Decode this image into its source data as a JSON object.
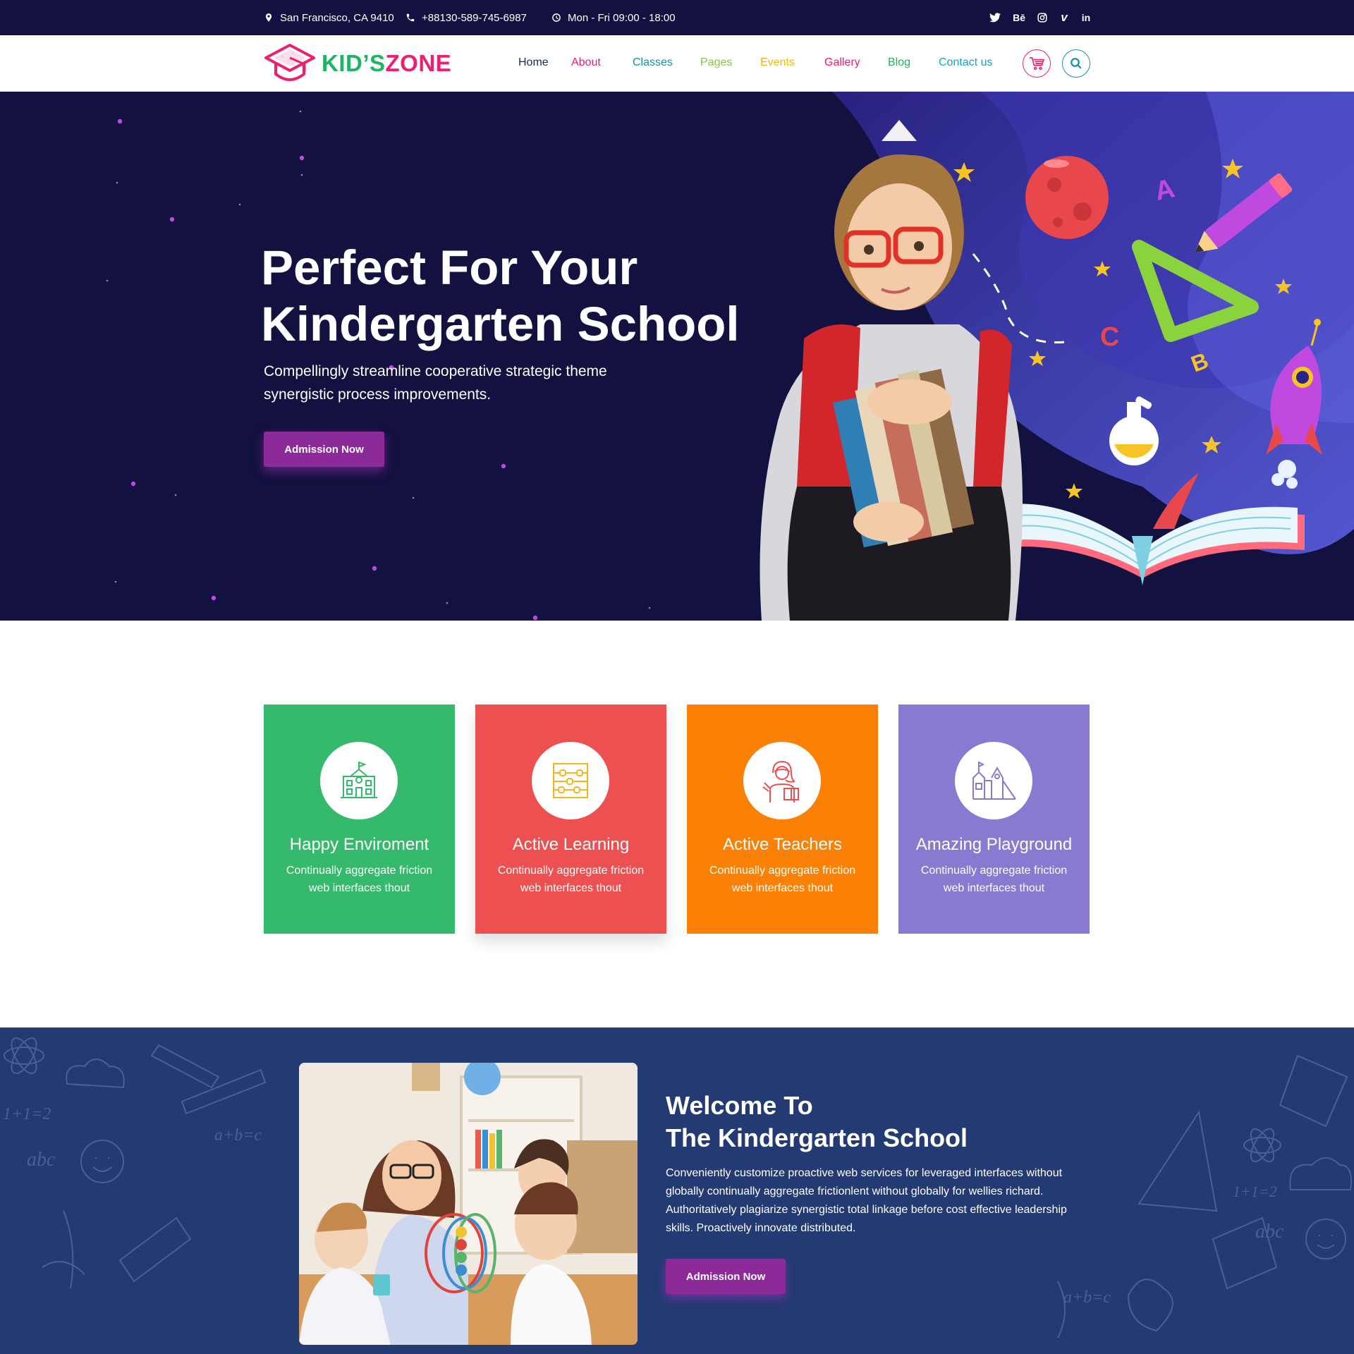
{
  "topbar": {
    "location": "San Francisco, CA 9410",
    "phone": "+88130-589-745-6987",
    "hours": "Mon - Fri 09:00 - 18:00",
    "social": [
      "twitter-icon",
      "behance-icon",
      "instagram-icon",
      "vimeo-icon",
      "linkedin-icon"
    ],
    "social_glyphs": {
      "behance": "Bē",
      "vimeo": "v",
      "linkedin": "in"
    }
  },
  "header": {
    "logo_part1": "KID’S",
    "logo_part2": "ZONE",
    "nav": [
      {
        "label": "Home",
        "color": "#1d2a4d"
      },
      {
        "label": "About",
        "color": "#ec1f70"
      },
      {
        "label": "Classes",
        "color": "#1a8fa6"
      },
      {
        "label": "Pages",
        "color": "#8bc34a"
      },
      {
        "label": "Events",
        "color": "#f5b800"
      },
      {
        "label": "Gallery",
        "color": "#ec1f70"
      },
      {
        "label": "Blog",
        "color": "#1fb463"
      },
      {
        "label": "Contact us",
        "color": "#1aa0c6"
      }
    ],
    "cart_icon": "cart-icon",
    "search_icon": "search-icon"
  },
  "hero": {
    "title_line1": "Perfect For Your",
    "title_line2": "Kindergarten School",
    "subtitle_line1": "Compellingly streamline cooperative strategic theme",
    "subtitle_line2": "synergistic process improvements.",
    "button": "Admission Now",
    "letters": [
      "A",
      "B",
      "C"
    ]
  },
  "features": [
    {
      "title": "Happy Enviroment",
      "text_line1": "Continually aggregate friction",
      "text_line2": "web interfaces thout",
      "color": "#35b96c",
      "icon": "school-building-icon"
    },
    {
      "title": "Active Learning",
      "text_line1": "Continually aggregate friction",
      "text_line2": "web interfaces thout",
      "color": "#ec5050",
      "icon": "abacus-icon"
    },
    {
      "title": "Active Teachers",
      "text_line1": "Continually aggregate friction",
      "text_line2": "web interfaces thout",
      "color": "#fb8106",
      "icon": "teacher-icon"
    },
    {
      "title": "Amazing Playground",
      "text_line1": "Continually aggregate friction",
      "text_line2": "web interfaces thout",
      "color": "#8a79d0",
      "icon": "playground-icon"
    }
  ],
  "welcome": {
    "title_line1": "Welcome To",
    "title_line2": "The Kindergarten School",
    "text": "Conveniently customize proactive web services for leveraged  interfaces without globally continually aggregate frictionlent without globally for wellies richard. Authoritatively plagiarize synergistic total linkage before cost effective leadership skills. Proactively innovate distributed.",
    "button": "Admission Now",
    "doodles": [
      "1+1=2",
      "abc",
      "a+b=c",
      "1+1=2",
      "abc",
      "a+b=c"
    ]
  },
  "colors": {
    "dark_navy": "#13113f",
    "welcome_blue": "#243a72",
    "purple_button": "#8b2a98"
  }
}
